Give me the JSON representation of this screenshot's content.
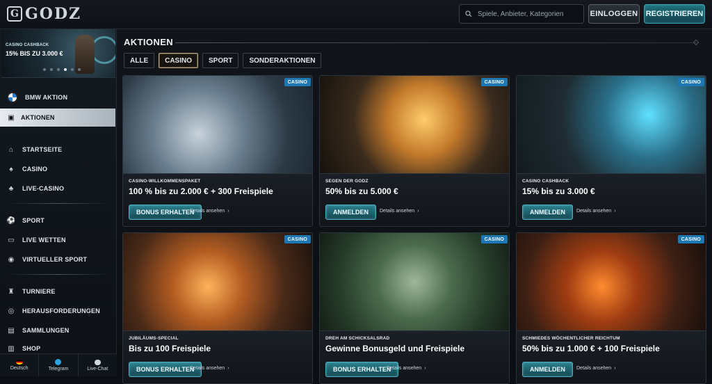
{
  "header": {
    "logo_text": "GODZ",
    "search_placeholder": "Spiele, Anbieter, Kategorien",
    "login_label": "EINLOGGEN",
    "register_label": "REGISTRIEREN"
  },
  "sidebar": {
    "promo": {
      "tag": "CASINO CASHBACK",
      "title": "15% BIS ZU 3.000 €"
    },
    "bmw_label": "BMW AKTION",
    "active_label": "AKTIONEN",
    "items": [
      {
        "label": "STARTSEITE",
        "icon": "home-icon"
      },
      {
        "label": "CASINO",
        "icon": "casino-icon"
      },
      {
        "label": "LIVE-CASINO",
        "icon": "live-casino-icon"
      },
      {
        "label": "SPORT",
        "icon": "sport-icon"
      },
      {
        "label": "LIVE WETTEN",
        "icon": "live-betting-icon"
      },
      {
        "label": "VIRTUELLER SPORT",
        "icon": "virtual-sport-icon"
      },
      {
        "label": "TURNIERE",
        "icon": "tournament-icon"
      },
      {
        "label": "HERAUSFORDERUNGEN",
        "icon": "challenge-icon"
      },
      {
        "label": "SAMMLUNGEN",
        "icon": "collection-icon"
      },
      {
        "label": "SHOP",
        "icon": "shop-icon"
      }
    ],
    "footer": {
      "language": "Deutsch",
      "telegram": "Telegram",
      "chat": "Live-Chat"
    }
  },
  "main": {
    "section_title": "AKTIONEN",
    "filters": [
      "ALLE",
      "CASINO",
      "SPORT",
      "SONDERAKTIONEN"
    ],
    "active_filter": "CASINO",
    "badge_label": "CASINO",
    "details_label": "Details ansehen",
    "cards": [
      {
        "subtitle": "CASINO-WILLKOMMENSPAKET",
        "offer": "100 % bis zu 2.000 € + 300 Freispiele",
        "cta": "BONUS ERHALTEN"
      },
      {
        "subtitle": "SEGEN DER GODZ",
        "offer": "50% bis zu 5.000 €",
        "cta": "ANMELDEN"
      },
      {
        "subtitle": "CASINO CASHBACK",
        "offer": "15% bis zu 3.000 €",
        "cta": "ANMELDEN"
      },
      {
        "subtitle": "JUBILÄUMS-SPECIAL",
        "offer": "Bis zu 100 Freispiele",
        "cta": "BONUS ERHALTEN"
      },
      {
        "subtitle": "DREH AM SCHICKSALSRAD",
        "offer": "Gewinne Bonusgeld und Freispiele",
        "cta": "BONUS ERHALTEN"
      },
      {
        "subtitle": "SCHMIEDES WÖCHENTLICHER REICHTUM",
        "offer": "50% bis zu 1.000 € + 100 Freispiele",
        "cta": "ANMELDEN"
      }
    ]
  },
  "colors": {
    "accent_teal": "#2a7f8c",
    "badge_blue": "#1c77b3",
    "active_filter_border": "#b8a37a"
  }
}
